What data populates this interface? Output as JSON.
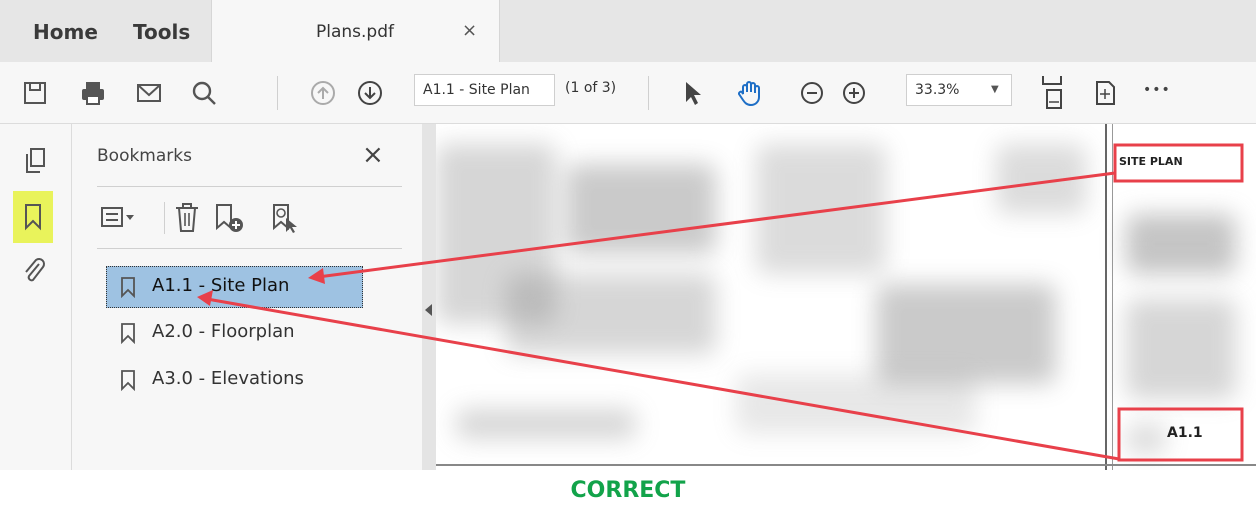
{
  "tabs": {
    "home": "Home",
    "tools": "Tools",
    "document": "Plans.pdf",
    "close_glyph": "×"
  },
  "toolbar": {
    "page_field": "A1.1 - Site Plan",
    "page_count": "(1 of 3)",
    "zoom": "33.3%",
    "more_glyph": "•••",
    "icons": [
      "save-icon",
      "print-icon",
      "email-icon",
      "search-icon",
      "previous-page-icon",
      "next-page-icon",
      "select-arrow-icon",
      "hand-tool-icon",
      "zoom-out-icon",
      "zoom-in-icon",
      "fit-page-icon",
      "page-tools-icon",
      "more-icon"
    ]
  },
  "rail": {
    "icons": [
      "pages-icon",
      "bookmarks-icon",
      "attachments-icon"
    ],
    "active": "bookmarks-icon",
    "active_color": "#e9f35b"
  },
  "bookmarks": {
    "title": "Bookmarks",
    "close_glyph": "×",
    "items": [
      {
        "label": "A1.1 - Site Plan",
        "selected": true
      },
      {
        "label": "A2.0 - Floorplan",
        "selected": false
      },
      {
        "label": "A3.0 - Elevations",
        "selected": false
      }
    ],
    "selection_color": "#9ec2e2"
  },
  "document": {
    "title_block_label": "SITE PLAN",
    "sheet_number": "A1.1",
    "callout_color": "#e8404a"
  },
  "caption": {
    "text": "CORRECT",
    "color": "#12a34a"
  }
}
